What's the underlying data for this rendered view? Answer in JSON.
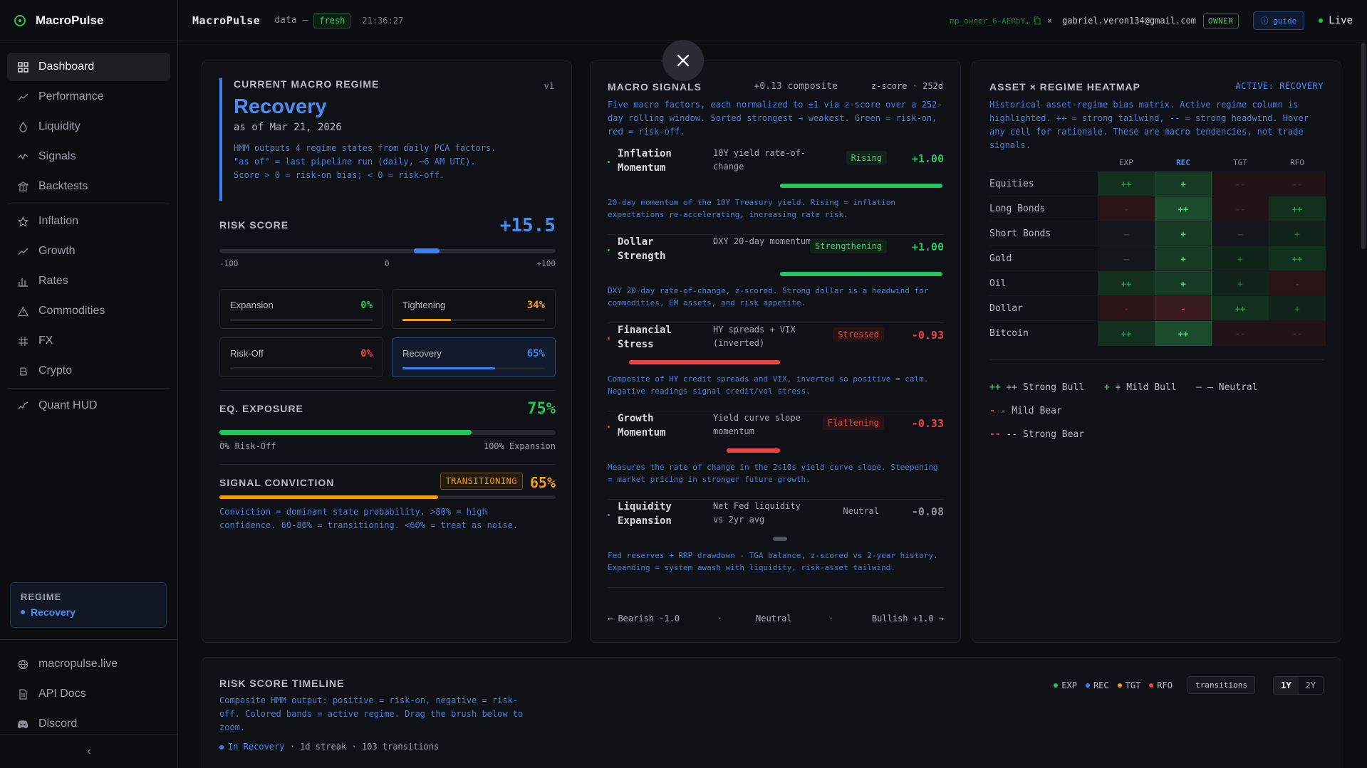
{
  "app": {
    "name": "MacroPulse"
  },
  "sidebar": {
    "items": [
      {
        "label": "Dashboard"
      },
      {
        "label": "Performance"
      },
      {
        "label": "Liquidity"
      },
      {
        "label": "Signals"
      },
      {
        "label": "Backtests"
      },
      {
        "label": "Inflation"
      },
      {
        "label": "Growth"
      },
      {
        "label": "Rates"
      },
      {
        "label": "Commodities"
      },
      {
        "label": "FX"
      },
      {
        "label": "Crypto"
      },
      {
        "label": "Quant HUD"
      }
    ],
    "regime_label": "REGIME",
    "regime_value": "Recovery",
    "links": [
      {
        "label": "macropulse.live"
      },
      {
        "label": "API Docs"
      },
      {
        "label": "Discord"
      }
    ],
    "collapse": "‹"
  },
  "header": {
    "title": "MacroPulse",
    "data_label": "data —",
    "fresh": "fresh",
    "time": "21:36:27",
    "key": "mp_owner_6-AERbY…",
    "x": "×",
    "email": "gabriel.veron134@gmail.com",
    "owner": "OWNER",
    "guide": "guide",
    "live": "Live"
  },
  "regime": {
    "title": "CURRENT MACRO REGIME",
    "version": "v1",
    "name": "Recovery",
    "as_of": "as of Mar 21, 2026",
    "description": "HMM outputs 4 regime states from daily PCA factors. \"as of\" = last pipeline run (daily, ~6 AM UTC). Score > 0 = risk-on bias; < 0 = risk-off.",
    "risk_label": "RISK SCORE",
    "risk_score": "+15.5",
    "risk_value": 15.5,
    "ticks": {
      "min": "-100",
      "mid": "0",
      "max": "+100"
    },
    "probs": [
      {
        "name": "Expansion",
        "pct": "0%",
        "value": 0,
        "color": "#22c55e"
      },
      {
        "name": "Tightening",
        "pct": "34%",
        "value": 34,
        "color": "#f59e0b"
      },
      {
        "name": "Risk-Off",
        "pct": "0%",
        "value": 0,
        "color": "#ef4444"
      },
      {
        "name": "Recovery",
        "pct": "65%",
        "value": 65,
        "color": "#3b82f6"
      }
    ],
    "eq_label": "EQ. EXPOSURE",
    "eq_value": "75%",
    "eq_fraction": 0.75,
    "eq_left": "0% Risk-Off",
    "eq_right": "100% Expansion",
    "conv_label": "SIGNAL CONVICTION",
    "conv_badge": "TRANSITIONING",
    "conv_value": "65%",
    "conv_fraction": 0.65,
    "conv_desc": "Conviction = dominant state probability. >80% = high confidence. 60-80% = transitioning. <60% = treat as noise."
  },
  "signals": {
    "title": "MACRO SIGNALS",
    "composite": "+0.13 composite",
    "method": "z-score · 252d",
    "description": "Five macro factors, each normalized to ±1 via z-score over a 252-day rolling window. Sorted strongest → weakest. Green = risk-on, red = risk-off.",
    "items": [
      {
        "name": "Inflation Momentum",
        "source": "10Y yield rate-of-change",
        "status": "Rising",
        "score": "+1.00",
        "value": 1.0,
        "color": "#22c55e",
        "explain": "20-day momentum of the 10Y Treasury yield. Rising = inflation expectations re-accelerating, increasing rate risk."
      },
      {
        "name": "Dollar Strength",
        "source": "DXY 20-day momentum",
        "status": "Strengthening",
        "score": "+1.00",
        "value": 1.0,
        "color": "#22c55e",
        "explain": "DXY 20-day rate-of-change, z-scored. Strong dollar is a headwind for commodities, EM assets, and risk appetite."
      },
      {
        "name": "Financial Stress",
        "source": "HY spreads + VIX (inverted)",
        "status": "Stressed",
        "score": "-0.93",
        "value": -0.93,
        "color": "#ef4444",
        "explain": "Composite of HY credit spreads and VIX, inverted so positive = calm. Negative readings signal credit/vol stress."
      },
      {
        "name": "Growth Momentum",
        "source": "Yield curve slope momentum",
        "status": "Flattening",
        "score": "-0.33",
        "value": -0.33,
        "color": "#ef4444",
        "explain": "Measures the rate of change in the 2s10s yield curve slope. Steepening = market pricing in stronger future growth."
      },
      {
        "name": "Liquidity Expansion",
        "source": "Net Fed liquidity vs 2yr avg",
        "status": "Neutral",
        "score": "-0.08",
        "value": -0.08,
        "color": "#6b7280",
        "explain": "Fed reserves + RRP drawdown - TGA balance, z-scored vs 2-year history. Expanding = system awash with liquidity, risk-asset tailwind."
      }
    ],
    "scale": {
      "left": "← Bearish -1.0",
      "dot1": "·",
      "mid": "Neutral",
      "dot2": "·",
      "right": "Bullish +1.0 →"
    }
  },
  "heatmap": {
    "title": "ASSET × REGIME HEATMAP",
    "active": "ACTIVE: RECOVERY",
    "description": "Historical asset-regime bias matrix. Active regime column is highlighted. ++ = strong tailwind, -- = strong headwind. Hover any cell for rationale. These are macro tendencies, not trade signals.",
    "columns": [
      "EXP",
      "REC",
      "TGT",
      "RFO"
    ],
    "active_col": 1,
    "rows": [
      {
        "asset": "Equities",
        "cells": [
          "++",
          "+",
          "--",
          "--"
        ]
      },
      {
        "asset": "Long Bonds",
        "cells": [
          "-",
          "++",
          "--",
          "++"
        ]
      },
      {
        "asset": "Short Bonds",
        "cells": [
          "—",
          "+",
          "—",
          "+"
        ]
      },
      {
        "asset": "Gold",
        "cells": [
          "—",
          "+",
          "+",
          "++"
        ]
      },
      {
        "asset": "Oil",
        "cells": [
          "++",
          "+",
          "+",
          "-"
        ]
      },
      {
        "asset": "Dollar",
        "cells": [
          "-",
          "-",
          "++",
          "+"
        ]
      },
      {
        "asset": "Bitcoin",
        "cells": [
          "++",
          "++",
          "--",
          "--"
        ]
      }
    ],
    "legend": [
      "++ Strong Bull",
      "+ Mild Bull",
      "— Neutral",
      "- Mild Bear",
      "-- Strong Bear"
    ]
  },
  "timeline": {
    "title": "RISK SCORE TIMELINE",
    "description": "Composite HMM output: positive = risk-on, negative = risk-off. Colored bands = active regime. Drag the brush below to zoom.",
    "status_in": "In Recovery",
    "status_rest": "· 1d streak · 103 transitions",
    "legend": [
      {
        "label": "EXP",
        "color": "#22c55e"
      },
      {
        "label": "REC",
        "color": "#3b82f6"
      },
      {
        "label": "TGT",
        "color": "#f59e0b"
      },
      {
        "label": "RFO",
        "color": "#ef4444"
      }
    ],
    "transitions": "transitions",
    "ranges": [
      "1Y",
      "2Y"
    ]
  }
}
